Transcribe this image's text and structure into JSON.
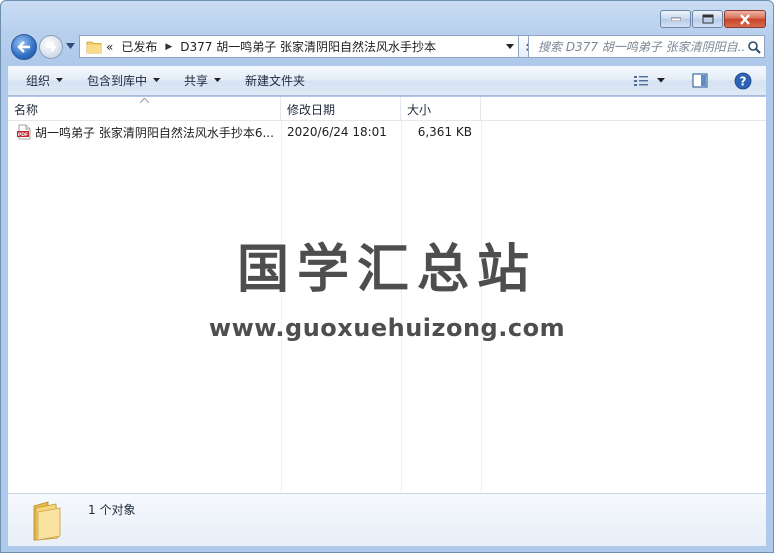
{
  "window": {
    "controls": {
      "minimize": "minimize",
      "maximize": "maximize",
      "close": "close"
    }
  },
  "address_bar": {
    "overflow": "«",
    "crumbs": [
      "已发布",
      "D377 胡一鸣弟子 张家清阴阳自然法风水手抄本"
    ]
  },
  "search": {
    "placeholder": "搜索 D377 胡一鸣弟子 张家清阴阳自..."
  },
  "commands": [
    {
      "label": "组织",
      "has_dropdown": true
    },
    {
      "label": "包含到库中",
      "has_dropdown": true
    },
    {
      "label": "共享",
      "has_dropdown": true
    },
    {
      "label": "新建文件夹",
      "has_dropdown": false
    }
  ],
  "columns": {
    "name": "名称",
    "date": "修改日期",
    "size": "大小"
  },
  "files": [
    {
      "name": "胡一鸣弟子 张家清阴阳自然法风水手抄本6...",
      "date": "2020/6/24 18:01",
      "size": "6,361 KB",
      "icon": "pdf-icon"
    }
  ],
  "watermark": {
    "title": "国学汇总站",
    "url": "www.guoxuehuizong.com"
  },
  "details": {
    "status": "1 个对象"
  },
  "colors": {
    "accent": "#2f6fc4",
    "pdf_red": "#c0262d",
    "folder": "#f3cf6b"
  }
}
